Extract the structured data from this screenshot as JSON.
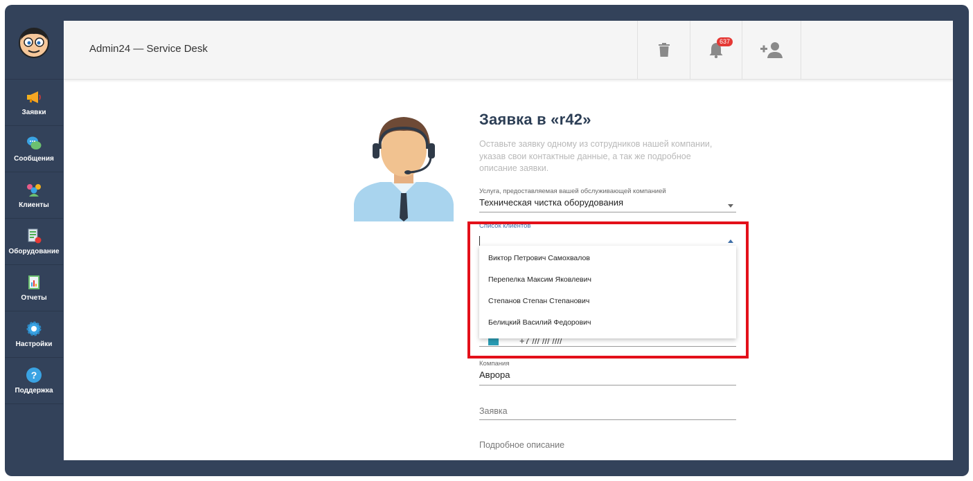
{
  "app": {
    "title": "Admin24 — Service Desk"
  },
  "toolbar": {
    "notifications_count": "637"
  },
  "sidebar": {
    "items": [
      {
        "label": "Заявки",
        "icon": "megaphone-icon"
      },
      {
        "label": "Сообщения",
        "icon": "chat-bubbles-icon"
      },
      {
        "label": "Клиенты",
        "icon": "people-icon"
      },
      {
        "label": "Оборудование",
        "icon": "equipment-icon"
      },
      {
        "label": "Отчеты",
        "icon": "report-icon"
      },
      {
        "label": "Настройки",
        "icon": "gear-icon"
      },
      {
        "label": "Поддержка",
        "icon": "help-icon"
      }
    ]
  },
  "form": {
    "title": "Заявка в «r42»",
    "description": "Оставьте заявку одному из сотрудников нашей компании, указав свои контактные данные, а так же подробное описание заявки.",
    "service": {
      "label": "Услуга, предоставляемая вашей обслуживающей компанией",
      "value": "Техническая чистка оборудования"
    },
    "clients": {
      "label": "Список клиентов",
      "value": "",
      "options": [
        "Виктор Петрович Самохвалов",
        "Перепелка Максим Яковлевич",
        "Степанов Степан Степанович",
        "Белицкий Василий Федорович"
      ]
    },
    "phone": {
      "value": "+7 /// /// ////"
    },
    "company": {
      "label": "Компания",
      "value": "Аврора"
    },
    "request": {
      "placeholder": "Заявка"
    },
    "details": {
      "placeholder": "Подробное описание"
    }
  },
  "colors": {
    "frame": "#33425a",
    "highlight": "#e3101a",
    "badge": "#e53935",
    "accent": "#3f6fa8"
  }
}
